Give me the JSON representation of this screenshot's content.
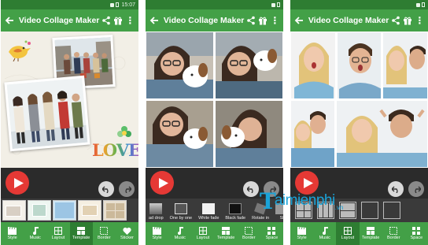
{
  "status": {
    "time": "15:07"
  },
  "app": {
    "title": "Video Collage Maker"
  },
  "love_text": "LOVE",
  "transitions": {
    "items": [
      "ad drop",
      "One by one",
      "White fade",
      "Black fade",
      "Rotate in",
      "Sl"
    ]
  },
  "nav_a": {
    "items": [
      {
        "label": "Style",
        "icon": "clapper-icon"
      },
      {
        "label": "Music",
        "icon": "music-note-icon"
      },
      {
        "label": "Layout",
        "icon": "layout-grid-icon"
      },
      {
        "label": "Template",
        "icon": "template-icon"
      },
      {
        "label": "Border",
        "icon": "border-icon"
      },
      {
        "label": "Sticker",
        "icon": "heart-icon"
      }
    ]
  },
  "nav_b": {
    "items": [
      {
        "label": "Style",
        "icon": "clapper-icon"
      },
      {
        "label": "Music",
        "icon": "music-note-icon"
      },
      {
        "label": "Layout",
        "icon": "layout-grid-icon"
      },
      {
        "label": "Template",
        "icon": "template-icon"
      },
      {
        "label": "Border",
        "icon": "border-icon"
      },
      {
        "label": "Space",
        "icon": "space-icon"
      }
    ]
  },
  "watermark": {
    "brand_letter": "T",
    "brand_rest": "aimienphi",
    "suffix": ".vn"
  },
  "colors": {
    "toolbar": "#43a047",
    "statusbar": "#2e7d32",
    "play": "#e53935",
    "strip": "#2b2b2b",
    "watermark": "#1aa3d8"
  }
}
